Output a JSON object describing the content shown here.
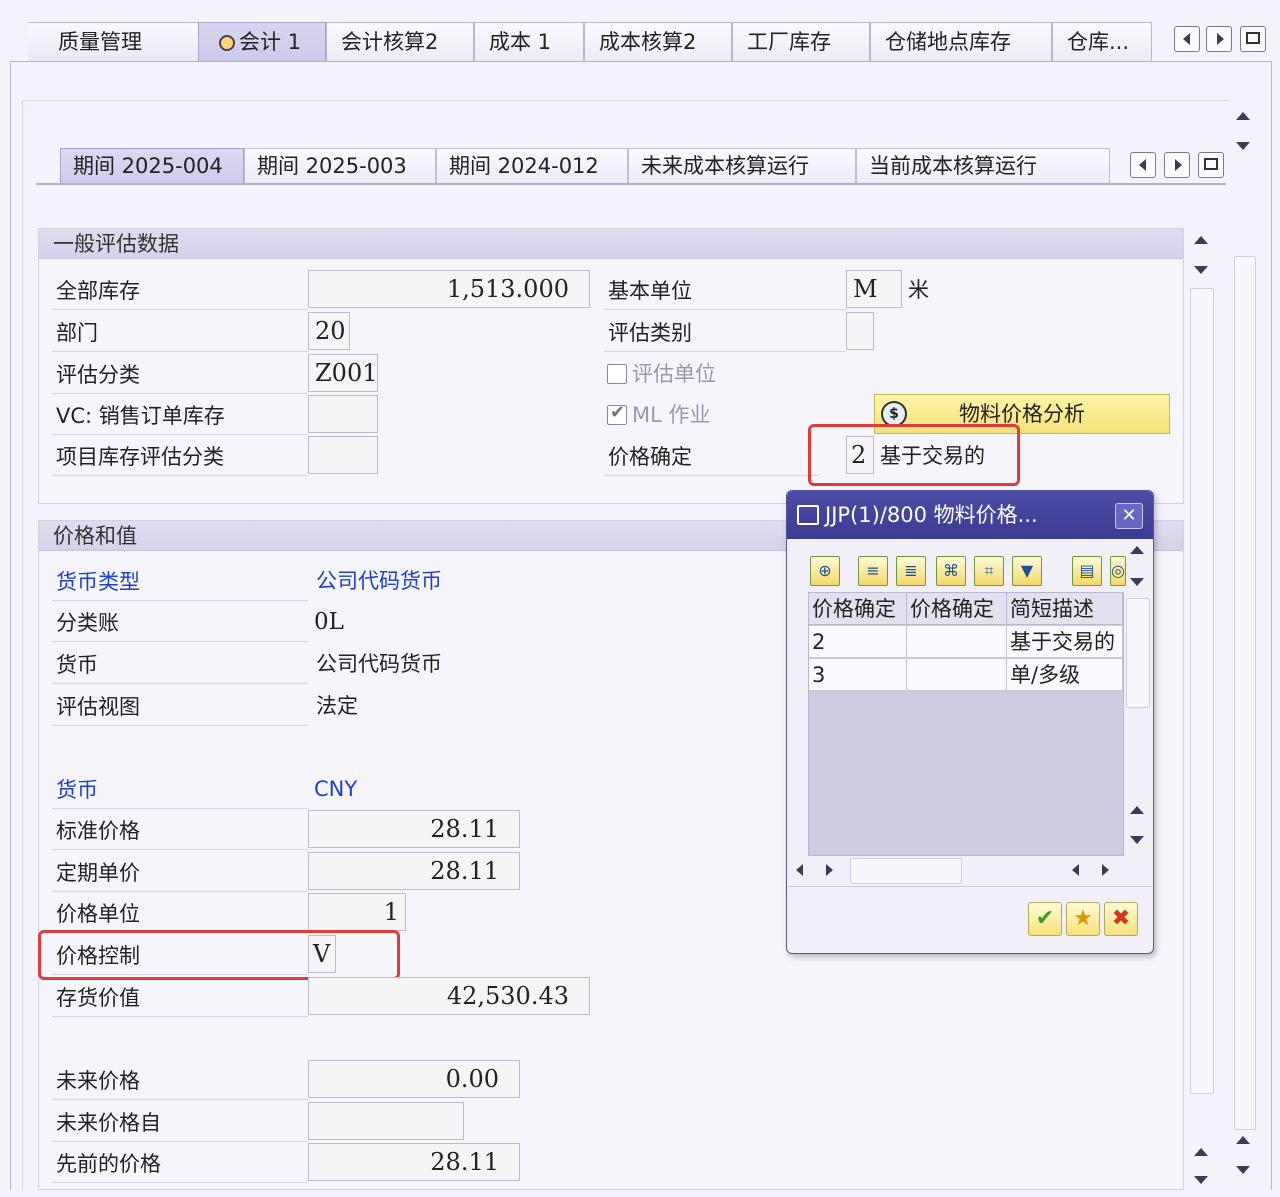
{
  "outer_tabs": [
    "质量管理",
    "会计 1",
    "会计核算2",
    "成本 1",
    "成本核算2",
    "工厂库存",
    "仓储地点库存",
    "仓库..."
  ],
  "period_tabs": [
    "期间 2025-004",
    "期间 2025-003",
    "期间 2024-012",
    "未来成本核算运行",
    "当前成本核算运行"
  ],
  "general": {
    "title": "一般评估数据",
    "total_stock_label": "全部库存",
    "total_stock": "1,513.000",
    "base_unit_label": "基本单位",
    "base_unit": "M",
    "base_unit_text": "米",
    "division_label": "部门",
    "division": "20",
    "valuation_category_label": "评估类别",
    "valuation_category": "",
    "valuation_class_label": "评估分类",
    "valuation_class": "Z001",
    "valuated_unit_label": "评估单位",
    "vc_label": "VC: 销售订单库存",
    "vc_value": "",
    "ml_label": "ML 作业",
    "project_label": "项目库存评估分类",
    "project_value": "",
    "price_determination_label": "价格确定",
    "price_determination": "2",
    "price_determination_text": "基于交易的",
    "price_analysis_button": "物料价格分析"
  },
  "prices": {
    "title": "价格和值",
    "currency_type_label": "货币类型",
    "currency_type": "公司代码货币",
    "ledger_label": "分类账",
    "ledger": "0L",
    "currency_label": "货币",
    "currency": "公司代码货币",
    "view_label": "评估视图",
    "view": "法定",
    "curr2_label": "货币",
    "curr2": "CNY",
    "std_price_label": "标准价格",
    "std_price": "28.11",
    "periodic_price_label": "定期单价",
    "periodic_price": "28.11",
    "price_unit_label": "价格单位",
    "price_unit": "1",
    "price_control_label": "价格控制",
    "price_control": "V",
    "inventory_value_label": "存货价值",
    "inventory_value": "42,530.43",
    "future_price_label": "未来价格",
    "future_price": "0.00",
    "future_price_from_label": "未来价格自",
    "future_price_from": "",
    "previous_price_label": "先前的价格",
    "previous_price": "28.11"
  },
  "dialog": {
    "title": "JJP(1)/800 物料价格...",
    "columns": [
      "价格确定",
      "价格确定",
      "简短描述"
    ],
    "rows": [
      {
        "code": "2",
        "mid": "",
        "desc": "基于交易的"
      },
      {
        "code": "3",
        "mid": "",
        "desc": "单/多级"
      }
    ]
  }
}
